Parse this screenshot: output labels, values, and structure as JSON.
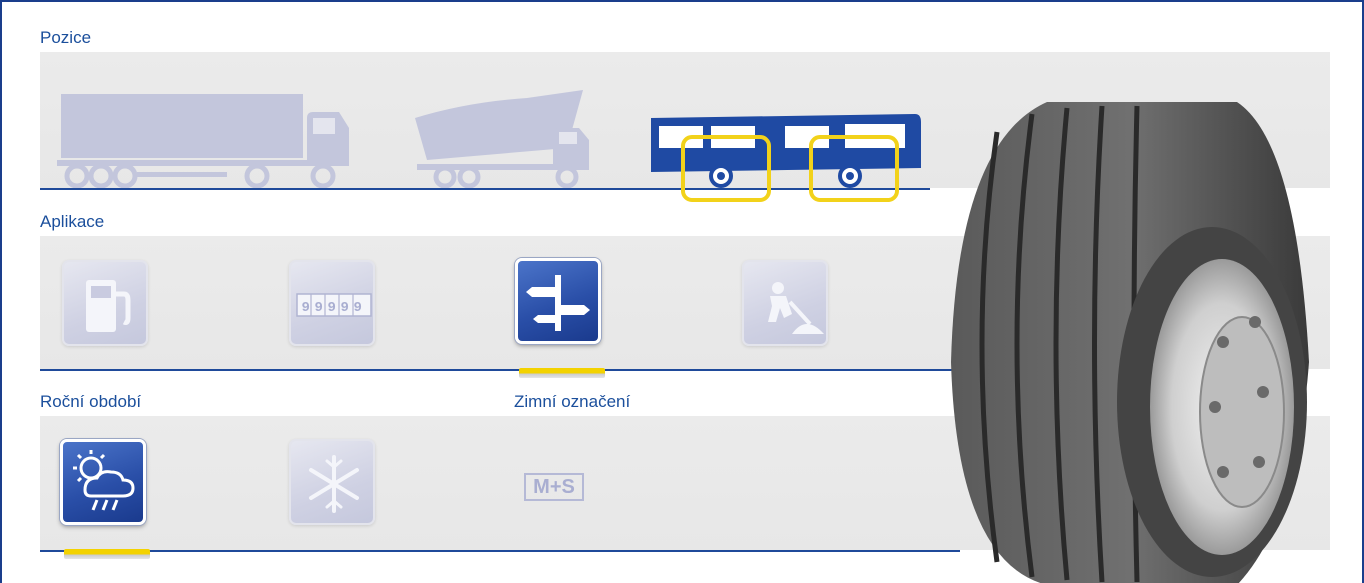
{
  "sections": {
    "position_title": "Pozice",
    "application_title": "Aplikace",
    "season_title": "Roční období",
    "winter_mark_title": "Zimní označení"
  },
  "positions": {
    "items": [
      {
        "icon": "truck-trailer-icon",
        "selected": false
      },
      {
        "icon": "dump-truck-icon",
        "selected": false
      },
      {
        "icon": "bus-icon",
        "selected": true
      }
    ]
  },
  "applications": {
    "items": [
      {
        "icon": "fuel-pump-icon",
        "selected": false
      },
      {
        "icon": "odometer-icon",
        "odometer_text": "99999",
        "selected": false
      },
      {
        "icon": "signpost-icon",
        "selected": true
      },
      {
        "icon": "road-worker-icon",
        "selected": false
      }
    ]
  },
  "seasons": {
    "items": [
      {
        "icon": "sun-rain-icon",
        "selected": true
      },
      {
        "icon": "snowflake-icon",
        "selected": false
      }
    ]
  },
  "winter_mark": {
    "label": "M+S"
  },
  "product": {
    "icon": "truck-tyre-image"
  },
  "colors": {
    "accent_blue": "#1f4a9a",
    "highlight_yellow": "#f3d200",
    "inactive_icon": "#c5c8dd"
  }
}
